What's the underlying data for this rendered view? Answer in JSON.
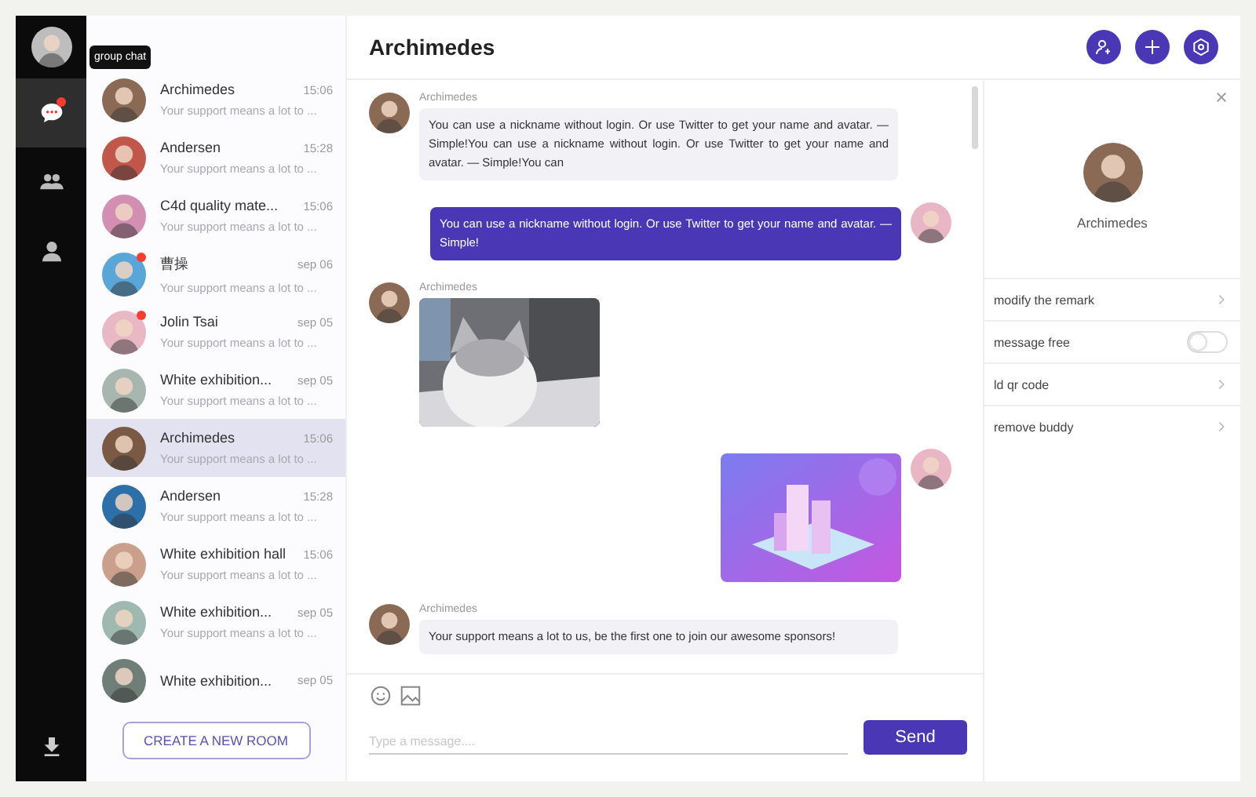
{
  "nav": {
    "items": [
      {
        "kind": "chat",
        "selected": true,
        "unread": true,
        "tooltip": "group chat"
      },
      {
        "kind": "group",
        "selected": false,
        "unread": false
      },
      {
        "kind": "person",
        "selected": false,
        "unread": false
      }
    ]
  },
  "conversations": [
    {
      "name": "Archimedes",
      "time": "15:06",
      "preview": "Your support means a lot to ...",
      "unread": false,
      "selected": false
    },
    {
      "name": "Andersen",
      "time": "15:28",
      "preview": "Your support means a lot to ...",
      "unread": false,
      "selected": false
    },
    {
      "name": "C4d quality mate...",
      "time": "15:06",
      "preview": "Your support means a lot to ...",
      "unread": false,
      "selected": false
    },
    {
      "name": "曹操",
      "time": "sep 06",
      "preview": "Your support means a lot to ...",
      "unread": true,
      "selected": false
    },
    {
      "name": "Jolin Tsai",
      "time": "sep 05",
      "preview": "Your support means a lot to ...",
      "unread": true,
      "selected": false
    },
    {
      "name": "White exhibition...",
      "time": "sep 05",
      "preview": "Your support means a lot to ...",
      "unread": false,
      "selected": false
    },
    {
      "name": "Archimedes",
      "time": "15:06",
      "preview": "Your support means a lot to ...",
      "unread": false,
      "selected": true
    },
    {
      "name": "Andersen",
      "time": "15:28",
      "preview": "Your support means a lot to ...",
      "unread": false,
      "selected": false
    },
    {
      "name": "White exhibition hall",
      "time": "15:06",
      "preview": "Your support means a lot to ...",
      "unread": false,
      "selected": false
    },
    {
      "name": "White exhibition...",
      "time": "sep 05",
      "preview": "Your support means a lot to ...",
      "unread": false,
      "selected": false
    },
    {
      "name": "White exhibition...",
      "time": "sep 05",
      "unread": false,
      "selected": false
    }
  ],
  "create_room_button": "CREATE A NEW ROOM",
  "chat": {
    "title": "Archimedes",
    "messages": [
      {
        "outgoing": false,
        "sender": "Archimedes",
        "kind": "text",
        "text": "You can use a nickname without login. Or use Twitter to get your name and avatar. — Simple!You can use a nickname without login. Or use Twitter to get your name and avatar. — Simple!You can"
      },
      {
        "outgoing": true,
        "kind": "text",
        "text": "You can use a nickname without login. Or use Twitter to get your name and avatar. — Simple!"
      },
      {
        "outgoing": false,
        "sender": "Archimedes"
      },
      {
        "outgoing": true,
        "kind": "illustration"
      },
      {
        "outgoing": false,
        "sender": "Archimedes",
        "kind": "text",
        "text": "Your support means a lot to us, be the first one to join our awesome sponsors!"
      }
    ],
    "input": {
      "placeholder": "Type a message...."
    },
    "send_button": "Send"
  },
  "profile": {
    "name": "Archimedes",
    "options": [
      {
        "label": "modify the remark",
        "kind": "link"
      },
      {
        "label": "message free",
        "kind": "toggle",
        "on": false
      },
      {
        "label": "ld qr code",
        "kind": "link"
      },
      {
        "label": "remove buddy",
        "kind": "link"
      }
    ]
  }
}
